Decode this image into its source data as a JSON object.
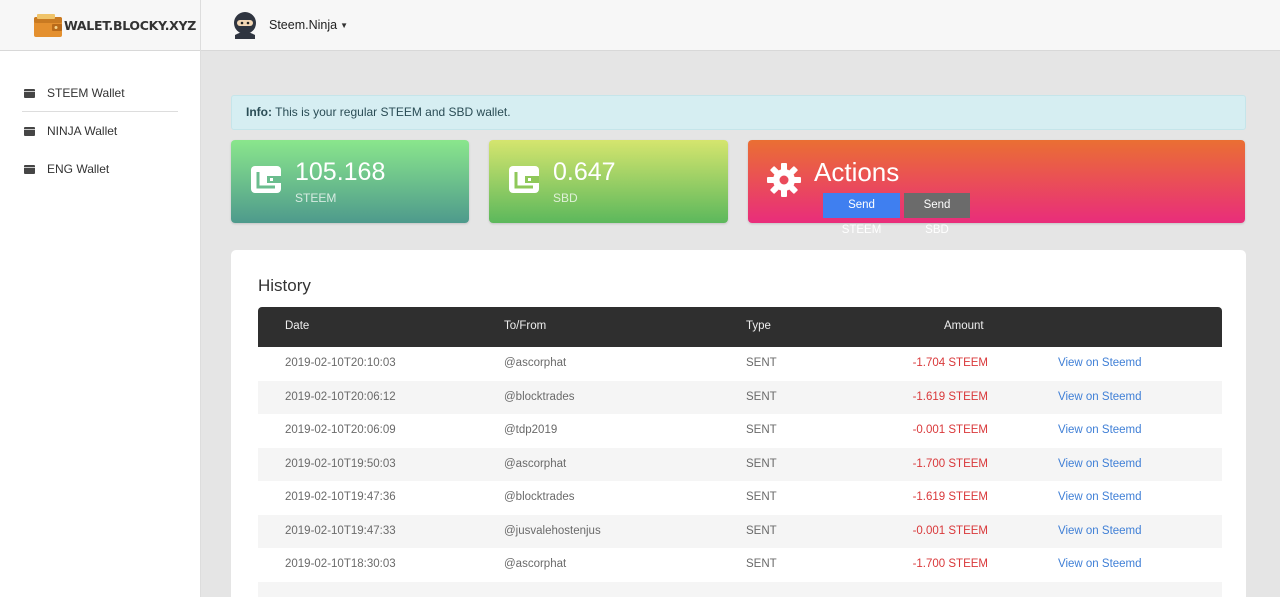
{
  "brand": {
    "name": "WALET.BLOCKY.XYZ"
  },
  "user": {
    "name": "Steem.Ninja"
  },
  "sidebar": {
    "items": [
      {
        "label": "STEEM Wallet"
      },
      {
        "label": "NINJA Wallet"
      },
      {
        "label": "ENG Wallet"
      }
    ]
  },
  "info": {
    "prefix": "Info:",
    "text": "This is your regular STEEM and SBD wallet."
  },
  "cards": {
    "steem": {
      "value": "105.168",
      "label": "STEEM"
    },
    "sbd": {
      "value": "0.647",
      "label": "SBD"
    },
    "actions": {
      "title": "Actions",
      "send_steem": "Send STEEM",
      "send_sbd": "Send SBD"
    }
  },
  "history": {
    "title": "History",
    "columns": [
      "Date",
      "To/From",
      "Type",
      "Amount"
    ],
    "rows": [
      {
        "date": "2019-02-10T20:10:03",
        "to": "@ascorphat",
        "type": "SENT",
        "amount": "-1.704 STEEM",
        "link": "View on Steemd"
      },
      {
        "date": "2019-02-10T20:06:12",
        "to": "@blocktrades",
        "type": "SENT",
        "amount": "-1.619 STEEM",
        "link": "View on Steemd"
      },
      {
        "date": "2019-02-10T20:06:09",
        "to": "@tdp2019",
        "type": "SENT",
        "amount": "-0.001 STEEM",
        "link": "View on Steemd"
      },
      {
        "date": "2019-02-10T19:50:03",
        "to": "@ascorphat",
        "type": "SENT",
        "amount": "-1.700 STEEM",
        "link": "View on Steemd"
      },
      {
        "date": "2019-02-10T19:47:36",
        "to": "@blocktrades",
        "type": "SENT",
        "amount": "-1.619 STEEM",
        "link": "View on Steemd"
      },
      {
        "date": "2019-02-10T19:47:33",
        "to": "@jusvalehostenjus",
        "type": "SENT",
        "amount": "-0.001 STEEM",
        "link": "View on Steemd"
      },
      {
        "date": "2019-02-10T18:30:03",
        "to": "@ascorphat",
        "type": "SENT",
        "amount": "-1.700 STEEM",
        "link": "View on Steemd"
      }
    ]
  },
  "colors": {
    "amount_negative": "#d9383a",
    "link": "#3f7fd6",
    "primary_button": "#3f7ff0"
  }
}
